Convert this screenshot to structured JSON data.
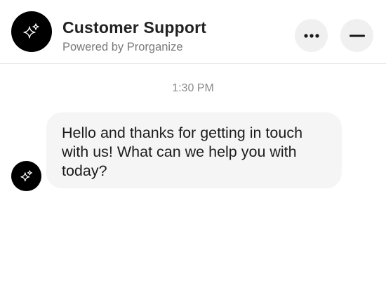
{
  "header": {
    "title": "Customer Support",
    "subtitle": "Powered by Prorganize",
    "avatar_icon": "sparkles-icon",
    "more_icon": "more-horizontal-icon",
    "minimize_icon": "minimize-icon"
  },
  "messages": [
    {
      "timestamp": "1:30 PM",
      "sender": "agent",
      "text": "Hello and thanks for getting in touch with us! What can we help you with today?"
    }
  ],
  "colors": {
    "avatar_bg": "#000000",
    "bubble_bg": "#f5f5f5",
    "header_button_bg": "#f0f0f0"
  }
}
